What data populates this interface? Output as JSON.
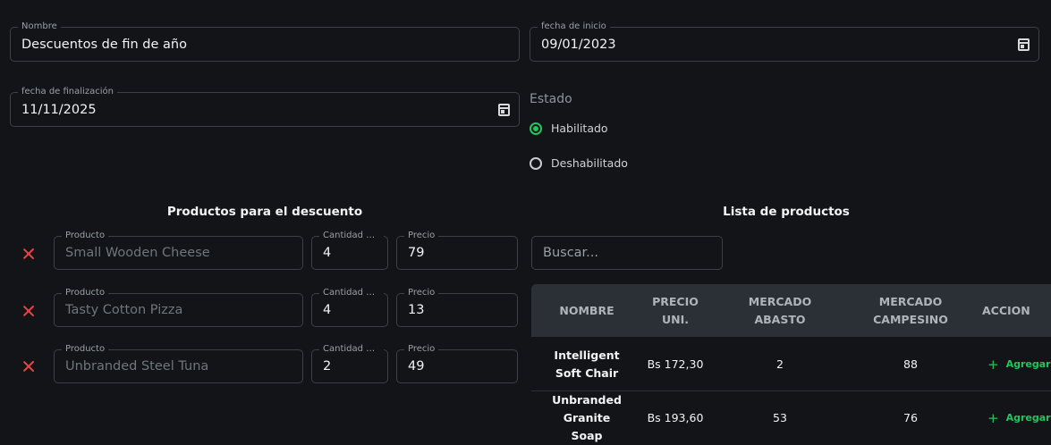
{
  "form": {
    "nombre": {
      "label": "Nombre",
      "value": "Descuentos de fin de año"
    },
    "fecha_inicio": {
      "label": "fecha de inicio",
      "value": "09/01/2023"
    },
    "fecha_fin": {
      "label": "fecha de finalización",
      "value": "11/11/2025"
    },
    "estado": {
      "label": "Estado",
      "options": [
        {
          "label": "Habilitado",
          "selected": true
        },
        {
          "label": "Deshabilitado",
          "selected": false
        }
      ]
    }
  },
  "discount_products": {
    "title": "Productos para el descuento",
    "product_label": "Producto",
    "qty_label": "Cantidad m...",
    "price_label": "Precio",
    "items": [
      {
        "product": "Small Wooden Cheese",
        "qty": "4",
        "price": "79"
      },
      {
        "product": "Tasty Cotton Pizza",
        "qty": "4",
        "price": "13"
      },
      {
        "product": "Unbranded Steel Tuna",
        "qty": "2",
        "price": "49"
      }
    ]
  },
  "product_list": {
    "title": "Lista de productos",
    "search_placeholder": "Buscar...",
    "columns": [
      "NOMBRE",
      "PRECIO UNI.",
      "MERCADO ABASTO",
      "MERCADO CAMPESINO",
      "ACCION"
    ],
    "rows": [
      {
        "name": "Intelligent Soft Chair",
        "price": "Bs 172,30",
        "abasto": "2",
        "campesino": "88",
        "action": "Agregar"
      },
      {
        "name": "Unbranded Granite Soap",
        "price": "Bs 193,60",
        "abasto": "53",
        "campesino": "76",
        "action": "Agregar"
      }
    ]
  },
  "colors": {
    "accent": "#22c55e",
    "danger": "#ef4444",
    "background": "#121417",
    "table_header": "#2b3036"
  }
}
